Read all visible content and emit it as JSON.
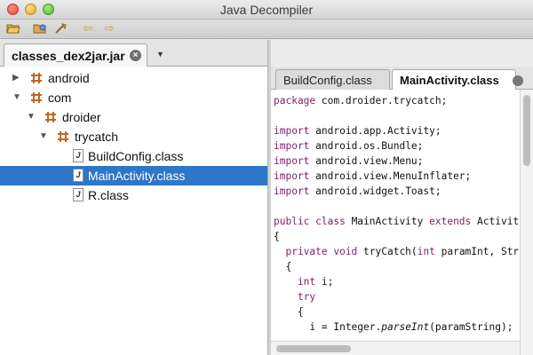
{
  "window": {
    "title": "Java Decompiler"
  },
  "toolbar": {
    "icons": [
      "open-file-icon",
      "open-type-icon",
      "settings-icon",
      "back-icon",
      "forward-icon"
    ]
  },
  "file_tab": {
    "label": "classes_dex2jar.jar",
    "close_glyph": "×",
    "dropdown_glyph": "▼"
  },
  "tree": {
    "items": [
      {
        "label": "android",
        "kind": "package",
        "expanded": false
      },
      {
        "label": "com",
        "kind": "package",
        "expanded": true
      },
      {
        "label": "droider",
        "kind": "package",
        "expanded": true
      },
      {
        "label": "trycatch",
        "kind": "package",
        "expanded": true
      },
      {
        "label": "BuildConfig.class",
        "kind": "class"
      },
      {
        "label": "MainActivity.class",
        "kind": "class",
        "selected": true
      },
      {
        "label": "R.class",
        "kind": "class"
      }
    ],
    "class_glyph": "J"
  },
  "code_tabs": [
    {
      "label": "BuildConfig.class",
      "active": false
    },
    {
      "label": "MainActivity.class",
      "active": true
    }
  ],
  "code": {
    "lines": [
      {
        "kw": "package",
        "rest": " com.droider.trycatch;"
      },
      {
        "kw": "",
        "rest": ""
      },
      {
        "kw": "import",
        "rest": " android.app.Activity;"
      },
      {
        "kw": "import",
        "rest": " android.os.Bundle;"
      },
      {
        "kw": "import",
        "rest": " android.view.Menu;"
      },
      {
        "kw": "import",
        "rest": " android.view.MenuInflater;"
      },
      {
        "kw": "import",
        "rest": " android.widget.Toast;"
      },
      {
        "kw": "",
        "rest": ""
      },
      {
        "kw": "public class",
        "rest": " MainActivity ",
        "kw2": "extends",
        "rest2": " Activity"
      },
      {
        "kw": "",
        "rest": "{"
      },
      {
        "kw": "  private void",
        "rest": " tryCatch(",
        "kw2": "int",
        "rest2": " paramInt, Str"
      },
      {
        "kw": "",
        "rest": "  {"
      },
      {
        "kw": "    int",
        "rest": " i;"
      },
      {
        "kw": "    try",
        "rest": ""
      },
      {
        "kw": "",
        "rest": "    {"
      },
      {
        "kw": "",
        "rest": "      i = Integer.",
        "it": "parseInt",
        "rest2": "(paramString);"
      }
    ]
  },
  "colors": {
    "selection": "#2e76c8",
    "keyword": "#7b1f66",
    "package_icon": "#c0681f"
  }
}
